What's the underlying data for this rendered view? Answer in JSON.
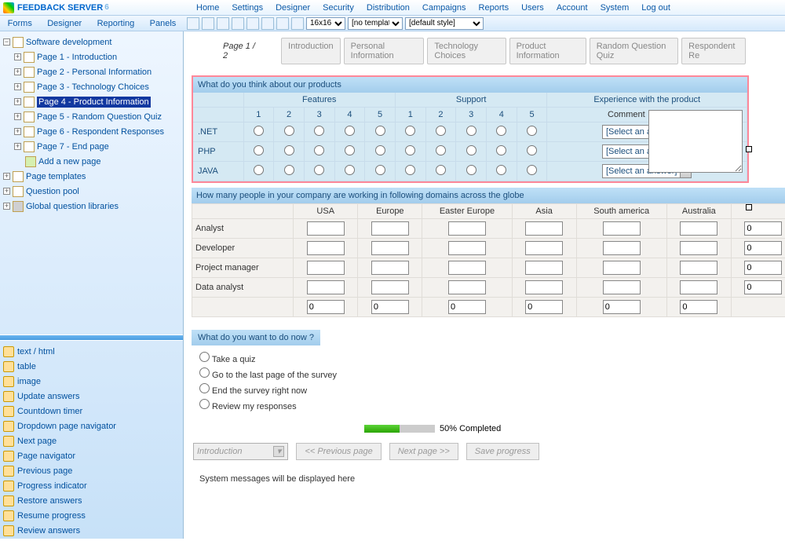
{
  "app": {
    "title": "FEEDBACK SERVER",
    "version": "6"
  },
  "mainnav": [
    "Home",
    "Settings",
    "Designer",
    "Security",
    "Distribution",
    "Campaigns",
    "Reports",
    "Users",
    "Account",
    "System",
    "Log out"
  ],
  "subnav": [
    "Forms",
    "Designer",
    "Reporting",
    "Panels"
  ],
  "toolbar": {
    "zoom": "16x16",
    "template": "[no template]",
    "style": "[default style]"
  },
  "tree": {
    "root": "Software development",
    "pages": [
      "Page 1 - Introduction",
      "Page 2 - Personal Information",
      "Page 3 - Technology Choices",
      "Page 4 - Product Information",
      "Page 5 - Random Question Quiz",
      "Page 6 - Respondent Responses",
      "Page 7 - End page"
    ],
    "addpage": "Add a new page",
    "other": [
      "Page templates",
      "Question pool",
      "Global question libraries"
    ],
    "selected": 3
  },
  "palette": [
    "text / html",
    "table",
    "image",
    "Update answers",
    "Countdown timer",
    "Dropdown page navigator",
    "Next page",
    "Page navigator",
    "Previous page",
    "Progress indicator",
    "Restore answers",
    "Resume progress",
    "Review answers"
  ],
  "page": {
    "label": "Page 1 / 2",
    "tabs": [
      "Introduction",
      "Personal Information",
      "Technology Choices",
      "Product Information",
      "Random Question Quiz",
      "Respondent Re"
    ]
  },
  "q1": {
    "title": "What do you think about our products",
    "groups": [
      "Features",
      "Support"
    ],
    "group3": "Experience with the product",
    "scale": [
      "1",
      "2",
      "3",
      "4",
      "5"
    ],
    "rows": [
      ".NET",
      "PHP",
      "JAVA"
    ],
    "select_placeholder": "[Select an answer]"
  },
  "q2": {
    "title": "How many people in your company are working in following domains across the globe",
    "cols": [
      "USA",
      "Europe",
      "Easter Europe",
      "Asia",
      "South america",
      "Australia"
    ],
    "rows": [
      "Analyst",
      "Developer",
      "Project manager",
      "Data analyst"
    ],
    "total_default": "0"
  },
  "comment_label": "Comment",
  "q3": {
    "title": "What do you want to do now  ?",
    "options": [
      "Take a quiz",
      "Go to the last page of the survey",
      "End the survey right now",
      "Review my responses"
    ]
  },
  "progress": {
    "percent": 50,
    "label": "50% Completed"
  },
  "nav": {
    "dropdown": "Introduction",
    "prev": "<< Previous page",
    "next": "Next page >>",
    "save": "Save progress"
  },
  "sysmsg": "System messages will be displayed here"
}
